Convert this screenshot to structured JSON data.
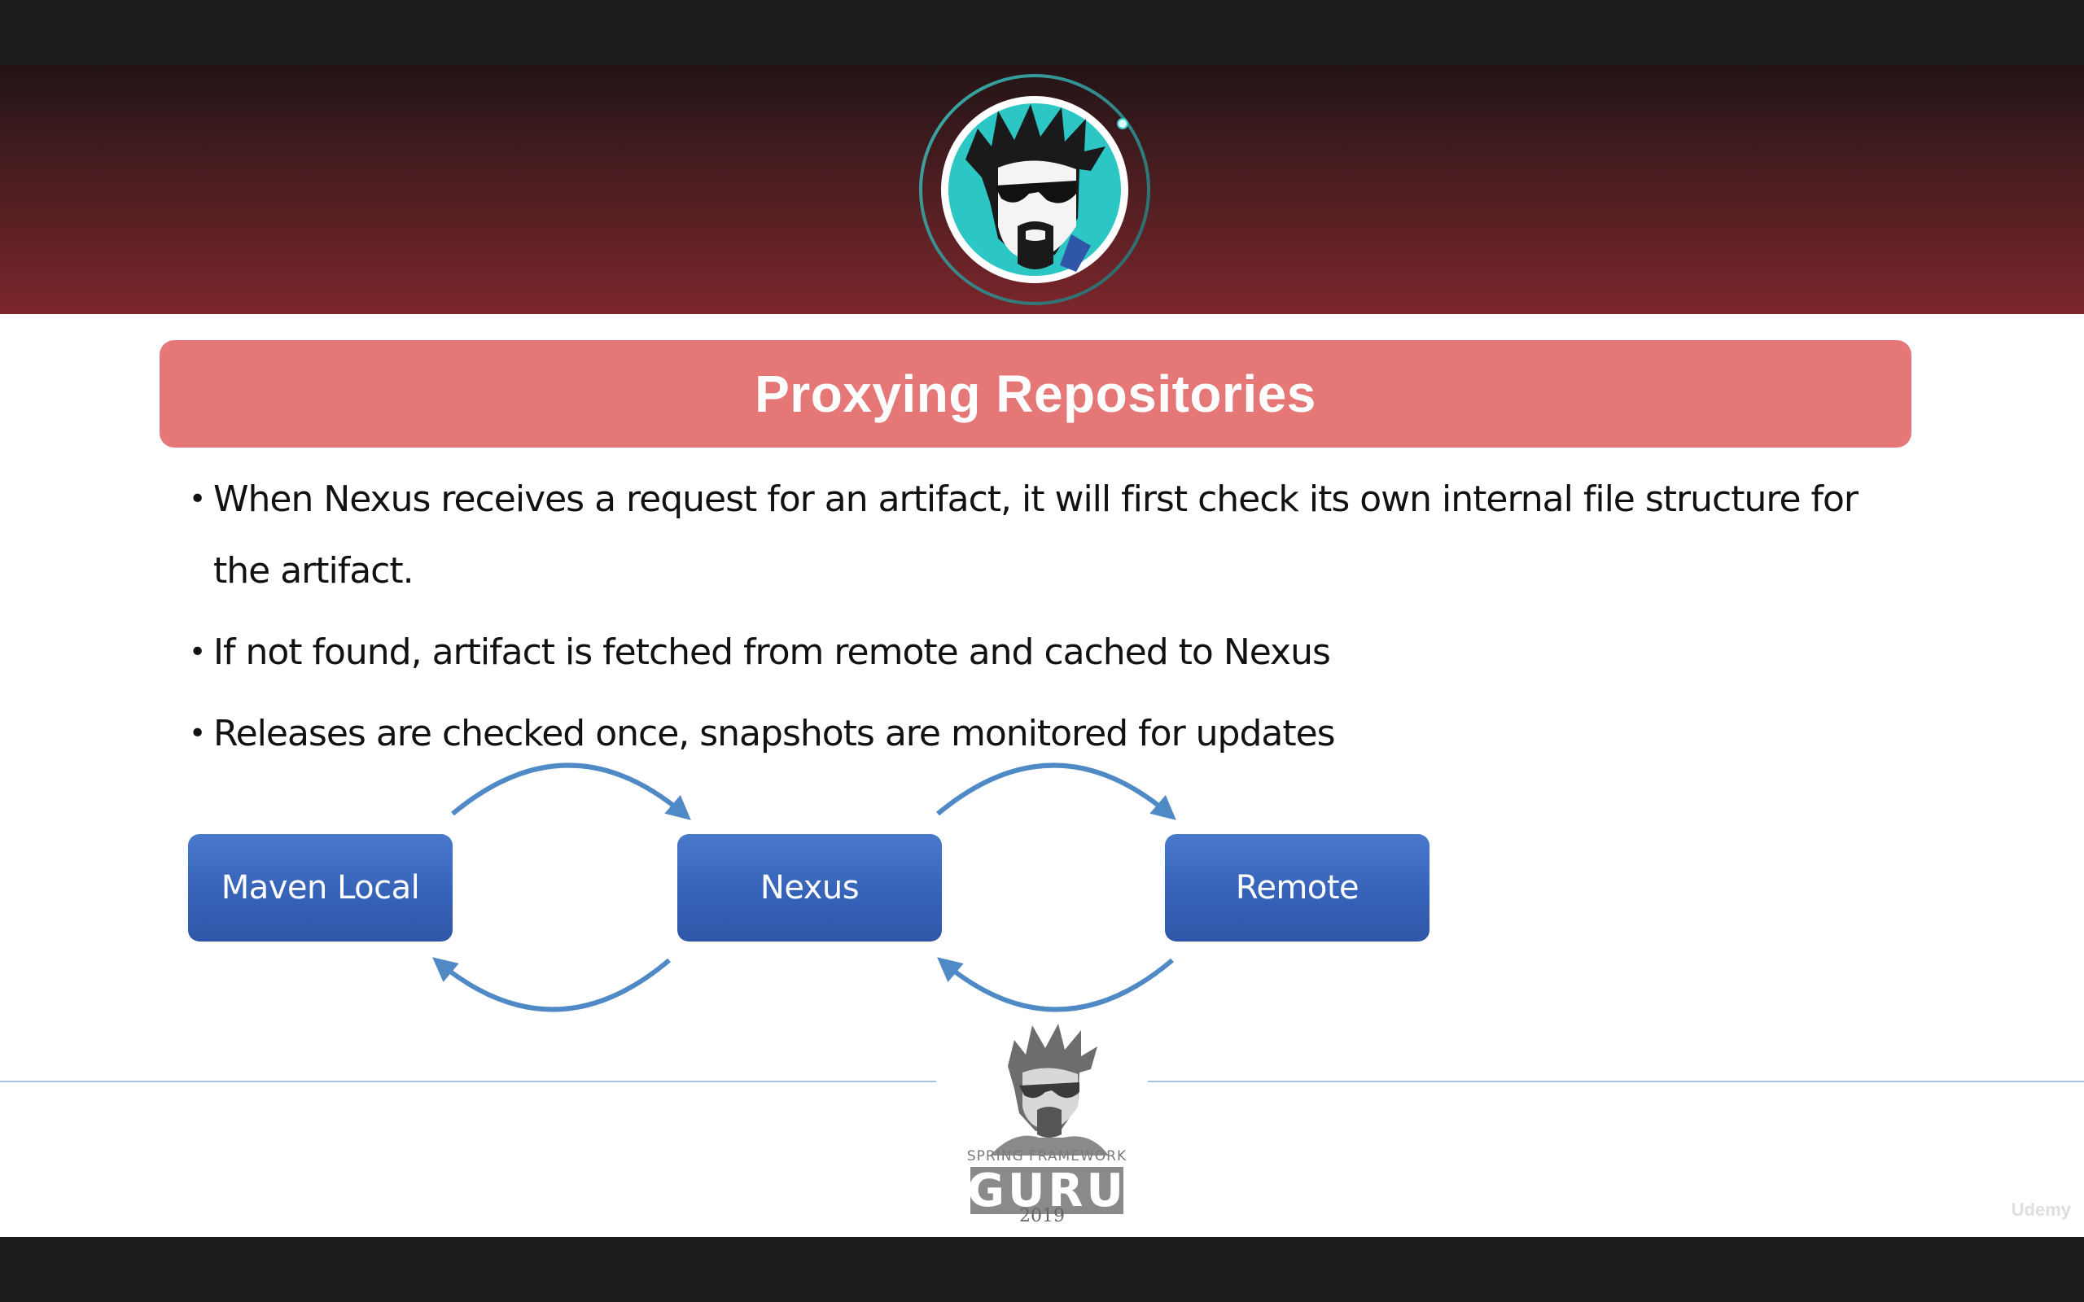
{
  "slide": {
    "title": "Proxying Repositories",
    "bullets": [
      {
        "text": "When Nexus receives a request for an artifact, it will first check its own internal file structure for",
        "text_cont": "the artifact."
      },
      {
        "text": "If not found, artifact is fetched from remote and cached to Nexus"
      },
      {
        "text": "Releases are checked once, snapshots are monitored for updates"
      }
    ],
    "diagram": {
      "boxes": [
        "Maven Local",
        "Nexus",
        "Remote"
      ]
    },
    "logo": {
      "line1": "SPRING FRAMEWORK",
      "line2": "GURU",
      "year": "2019"
    }
  },
  "player": {
    "watermark": "Udemy"
  },
  "colors": {
    "header_gradient": [
      "#221416",
      "#7c262b"
    ],
    "title_bg": "#e57877",
    "box_blue": "#3663b8",
    "arrow_blue": "#4f8ac6",
    "avatar_ring": "#2aa6a6"
  },
  "icons": [
    "instructor-avatar-icon",
    "guru-logo-icon",
    "udemy-logo-icon"
  ]
}
